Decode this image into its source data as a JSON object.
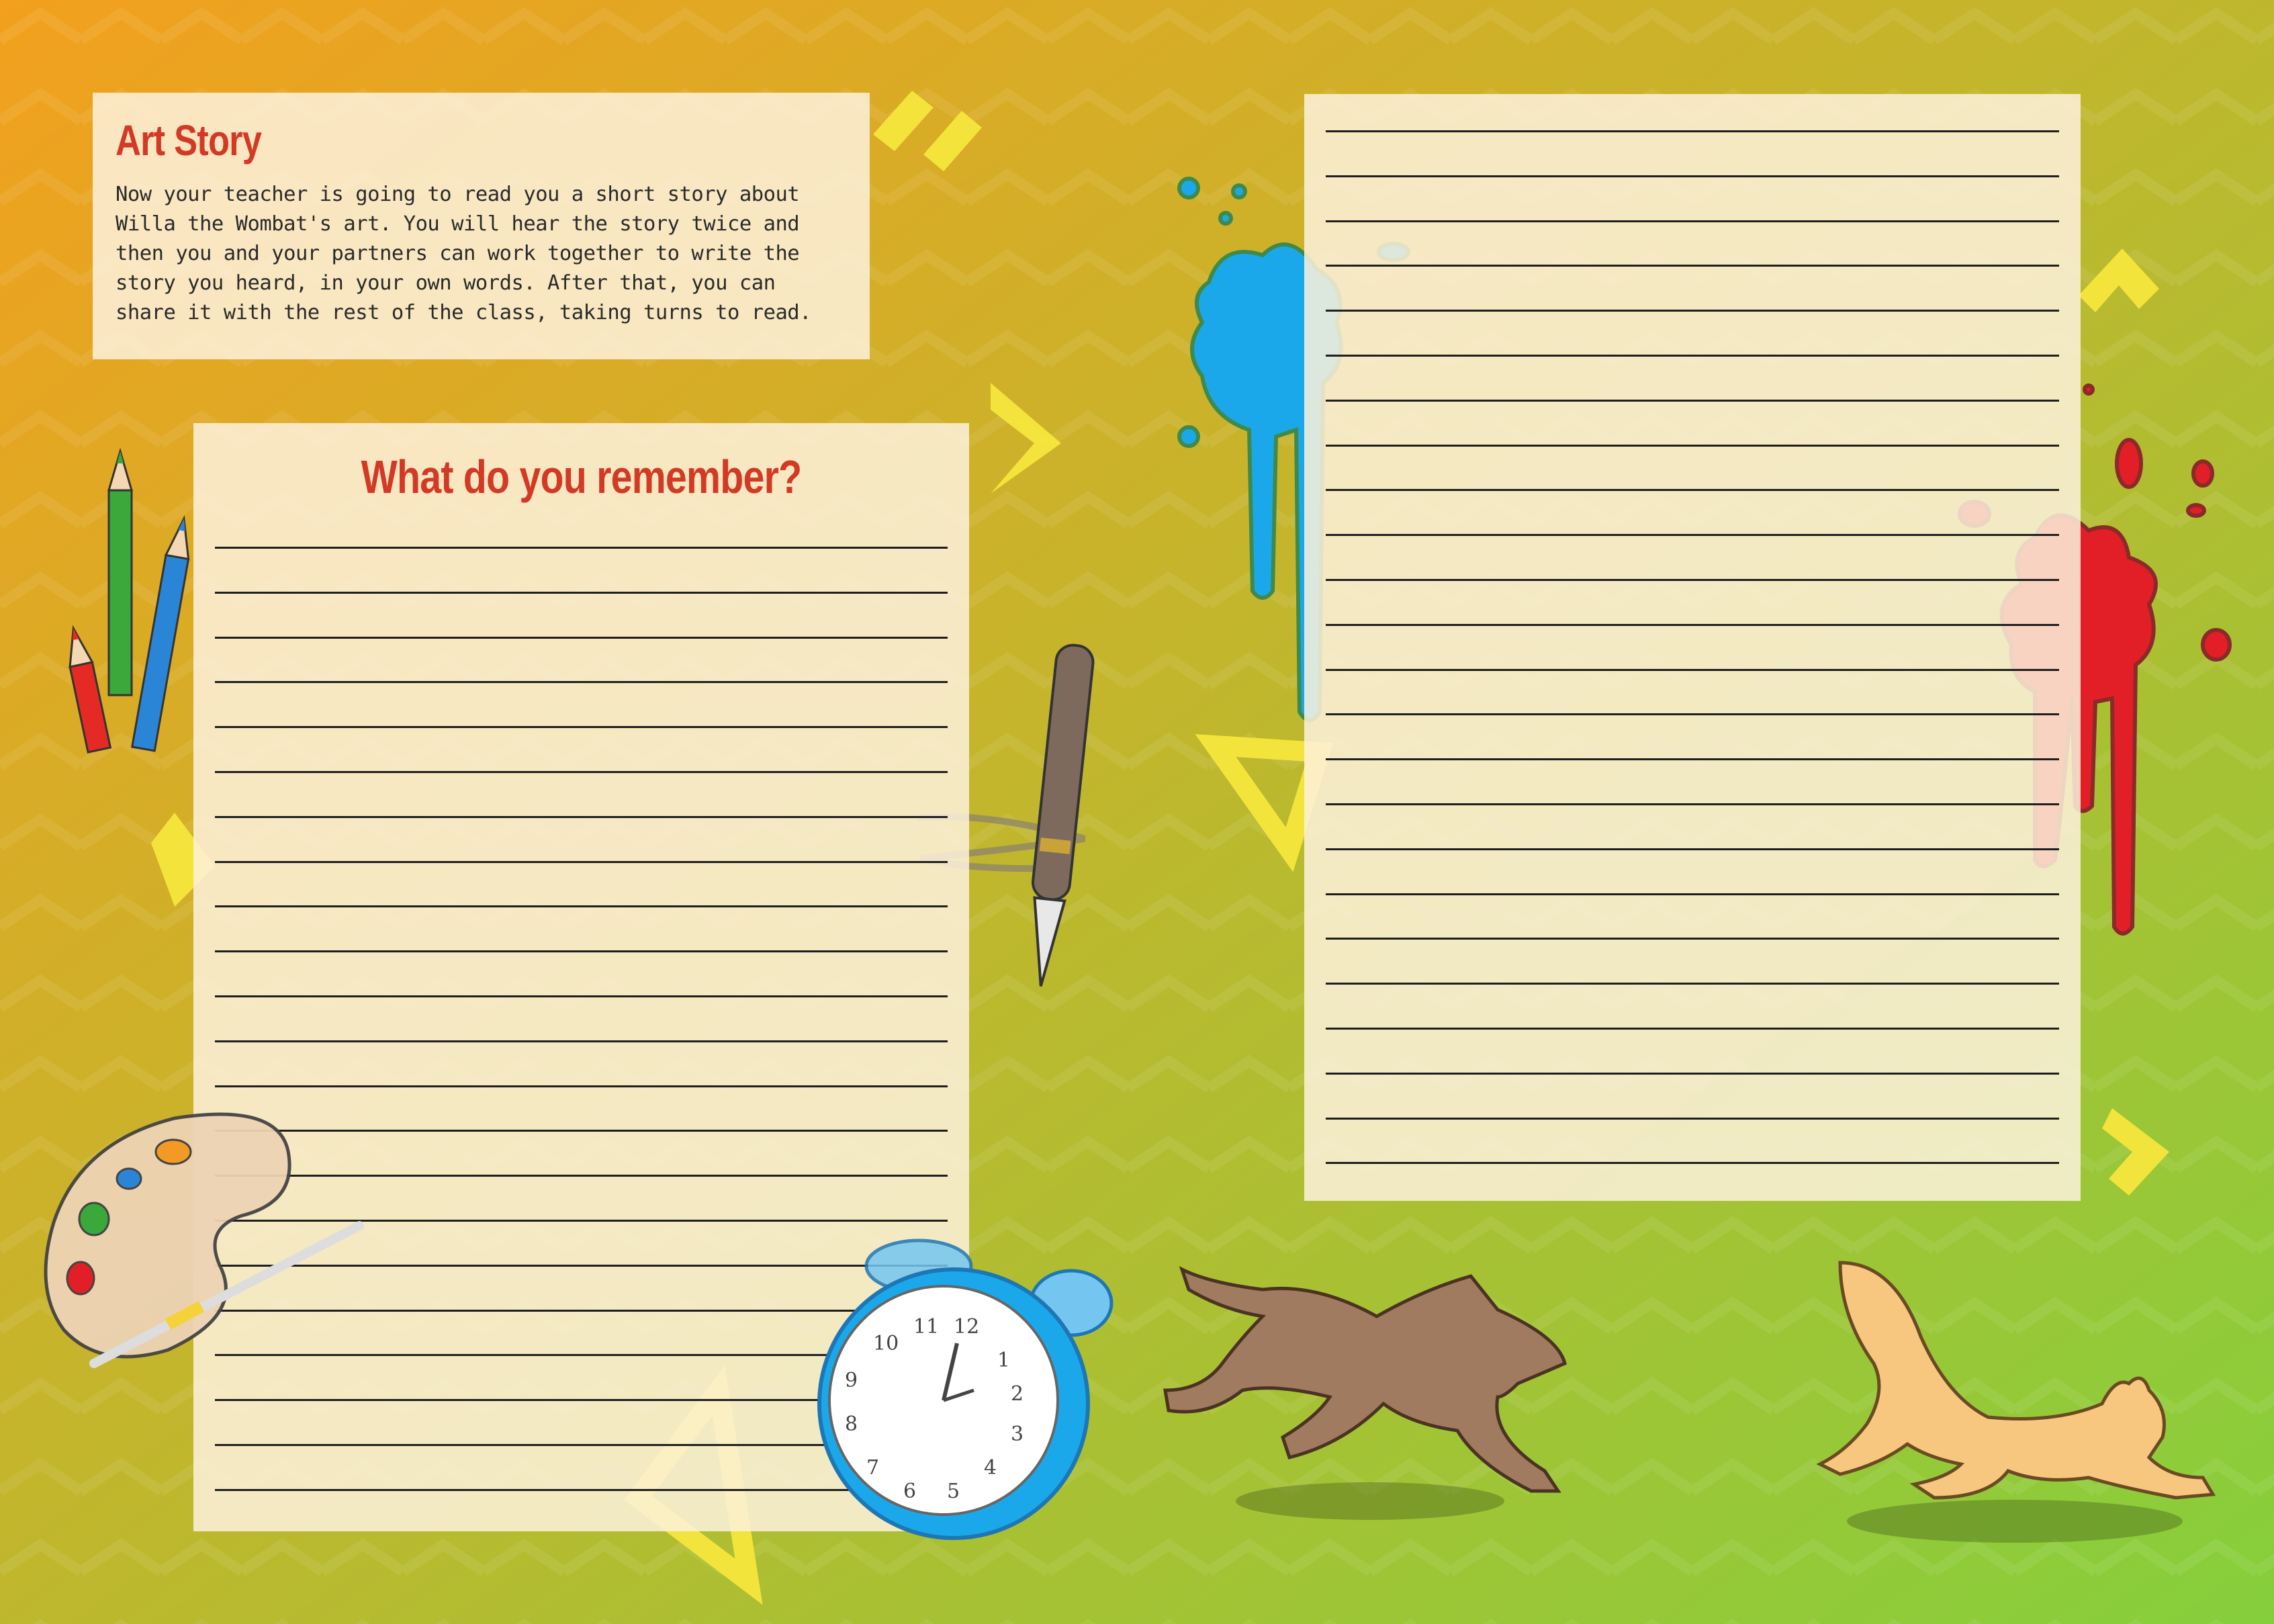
{
  "intro": {
    "title": "Art Story",
    "text": "Now your teacher is going to read you a short story about Willa the Wombat's art. You will hear the story twice and then you and your partners can work together to write the story you heard, in your own words. After that, you can share it with the rest of the class, taking turns to read."
  },
  "remember": {
    "title": "What do you remember?",
    "line_count": 22
  },
  "right_sheet": {
    "line_count": 24
  },
  "colors": {
    "heading": "#d23a25",
    "panel": "#fdf1db",
    "bg_orange": "#f2a01e",
    "bg_olive": "#c4b52c",
    "bg_green": "#86cf3c",
    "accent_yellow": "#f5e63c"
  },
  "icons": [
    "pencils-icon",
    "paint-palette-icon",
    "fountain-pen-icon",
    "blue-paint-splat-icon",
    "red-paint-splat-icon",
    "alarm-clock-icon",
    "running-dog-icon",
    "running-cat-icon"
  ]
}
